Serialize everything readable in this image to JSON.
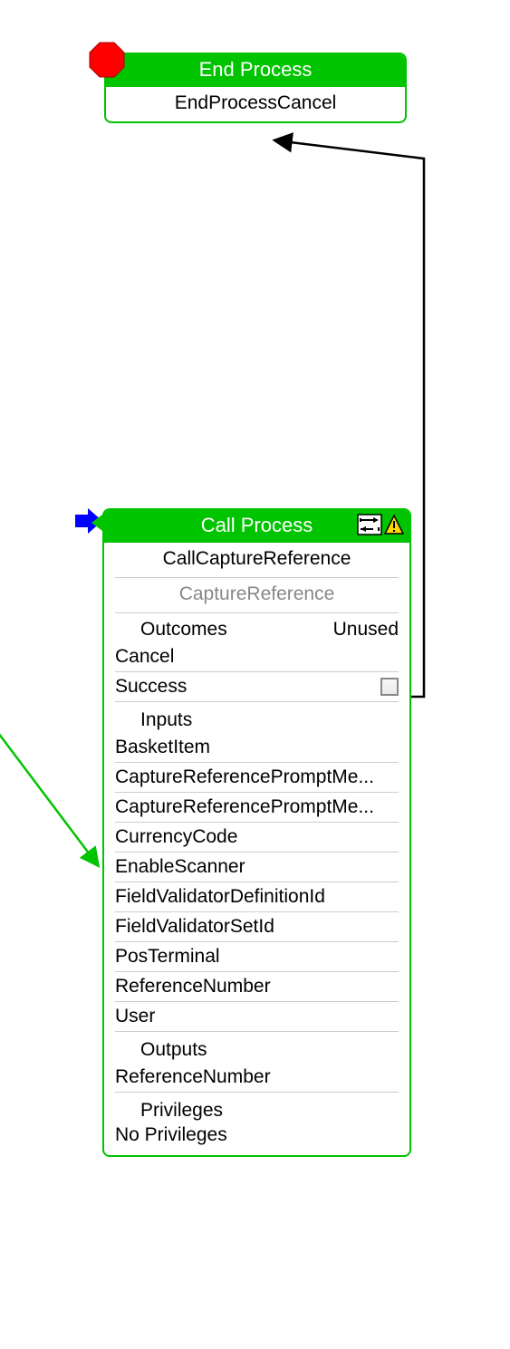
{
  "colors": {
    "primary": "#00c400",
    "arrow_black": "#000000",
    "arrow_green": "#00c400",
    "stop_red": "#ff0000",
    "blue_arrow": "#0000ff",
    "green_arrow": "#00c400",
    "warn_fill": "#ffd800"
  },
  "end_node": {
    "title": "End Process",
    "name": "EndProcessCancel"
  },
  "call_node": {
    "title": "Call Process",
    "name": "CallCaptureReference",
    "target": "CaptureReference",
    "outcomes": {
      "section_label": "Outcomes",
      "unused_label": "Unused",
      "items": [
        {
          "label": "Cancel",
          "unused_checked": null
        },
        {
          "label": "Success",
          "unused_checked": false
        }
      ]
    },
    "inputs": {
      "section_label": "Inputs",
      "items": [
        "BasketItem",
        "CaptureReferencePromptMe...",
        "CaptureReferencePromptMe...",
        "CurrencyCode",
        "EnableScanner",
        "FieldValidatorDefinitionId",
        "FieldValidatorSetId",
        "PosTerminal",
        "ReferenceNumber",
        "User"
      ]
    },
    "outputs": {
      "section_label": "Outputs",
      "items": [
        "ReferenceNumber"
      ]
    },
    "privileges": {
      "section_label": "Privileges",
      "value": "No Privileges"
    }
  },
  "connectors": [
    {
      "from": "call_node.header",
      "to": "end_node",
      "color": "#000000"
    },
    {
      "from": "offscreen_left",
      "to": "call_node",
      "color": "#00c400"
    }
  ]
}
